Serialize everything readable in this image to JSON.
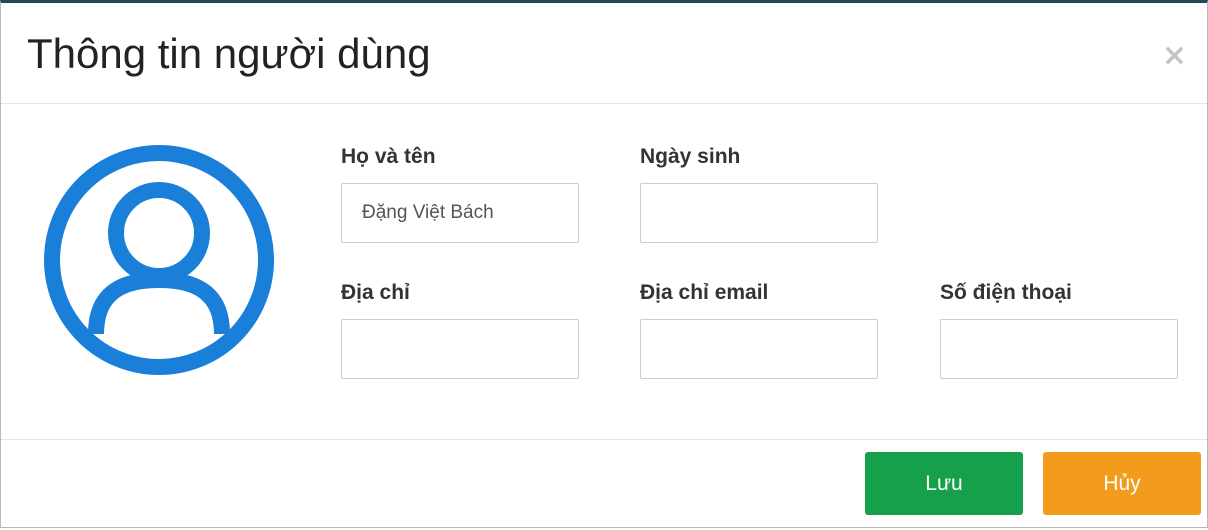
{
  "modal": {
    "title": "Thông tin người dùng",
    "close_glyph": "×"
  },
  "avatar": {
    "icon": "user-circle-icon",
    "color": "#1a7fd8"
  },
  "form": {
    "fullname": {
      "label": "Họ và tên",
      "value": "Đặng Việt Bách"
    },
    "birthday": {
      "label": "Ngày sinh",
      "value": ""
    },
    "address": {
      "label": "Địa chỉ",
      "value": ""
    },
    "email": {
      "label": "Địa chỉ email",
      "value": ""
    },
    "phone": {
      "label": "Số điện thoại",
      "value": ""
    }
  },
  "footer": {
    "save_label": "Lưu",
    "cancel_label": "Hủy",
    "save_color": "#17a04c",
    "cancel_color": "#f29b1d"
  }
}
